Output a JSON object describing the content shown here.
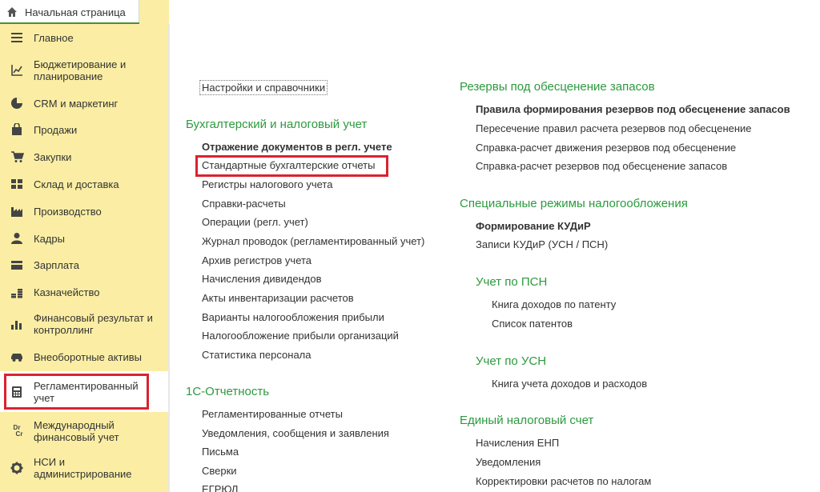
{
  "tabs": {
    "home_label": "Начальная страница"
  },
  "sidebar": {
    "items": [
      {
        "label": "Главное",
        "icon": "menu-lines-icon"
      },
      {
        "label": "Бюджетирование и планирование",
        "icon": "chart-line-icon"
      },
      {
        "label": "CRM и маркетинг",
        "icon": "pie-chart-icon"
      },
      {
        "label": "Продажи",
        "icon": "shopping-bag-icon"
      },
      {
        "label": "Закупки",
        "icon": "cart-icon"
      },
      {
        "label": "Склад и доставка",
        "icon": "warehouse-grid-icon"
      },
      {
        "label": "Производство",
        "icon": "factory-icon"
      },
      {
        "label": "Кадры",
        "icon": "person-icon"
      },
      {
        "label": "Зарплата",
        "icon": "wallet-icon"
      },
      {
        "label": "Казначейство",
        "icon": "coins-icon"
      },
      {
        "label": "Финансовый результат и контроллинг",
        "icon": "bar-chart-icon"
      },
      {
        "label": "Внеоборотные активы",
        "icon": "car-icon"
      },
      {
        "label": "Регламентированный учет",
        "icon": "calculator-icon"
      },
      {
        "label": "Международный финансовый учет",
        "icon": "dr-cr-icon"
      },
      {
        "label": "НСИ и администрирование",
        "icon": "gear-icon"
      }
    ],
    "drcr_top": "Dr",
    "drcr_bottom": "Cr"
  },
  "main": {
    "settings_link": "Настройки и справочники",
    "left": {
      "sections": [
        {
          "title": "Бухгалтерский и налоговый учет",
          "items": [
            "Отражение документов в регл. учете",
            "Стандартные бухгалтерские отчеты",
            "Регистры налогового учета",
            "Справки-расчеты",
            "Операции (регл. учет)",
            "Журнал проводок (регламентированный учет)",
            "Архив регистров учета",
            "Начисления дивидендов",
            "Акты инвентаризации расчетов",
            "Варианты налогообложения прибыли",
            "Налогообложение прибыли организаций",
            "Статистика персонала"
          ]
        },
        {
          "title": "1С-Отчетность",
          "items": [
            "Регламентированные отчеты",
            "Уведомления, сообщения и заявления",
            "Письма",
            "Сверки",
            "ЕГРЮЛ"
          ]
        }
      ]
    },
    "right": {
      "sections": [
        {
          "title": "Резервы под обесценение запасов",
          "items": [
            "Правила формирования резервов под обесценение запасов",
            "Пересечение правил расчета резервов под обесценение",
            "Справка-расчет движения резервов под обесценение",
            "Справка-расчет резервов под обесценение запасов"
          ]
        },
        {
          "title": "Специальные режимы налогообложения",
          "items": [
            "Формирование КУДиР",
            "Записи КУДиР (УСН / ПСН)"
          ]
        },
        {
          "title": "Учет по ПСН",
          "items": [
            "Книга доходов по патенту",
            "Список патентов"
          ]
        },
        {
          "title": "Учет по УСН",
          "items": [
            "Книга учета доходов и расходов"
          ]
        },
        {
          "title": "Единый налоговый счет",
          "items": [
            "Начисления ЕНП",
            "Уведомления",
            "Корректировки расчетов по налогам"
          ]
        }
      ]
    }
  },
  "colors": {
    "sidebar_bg": "#fbeea4",
    "section_title": "#2c9a3e",
    "highlight_box": "#d9232e"
  }
}
